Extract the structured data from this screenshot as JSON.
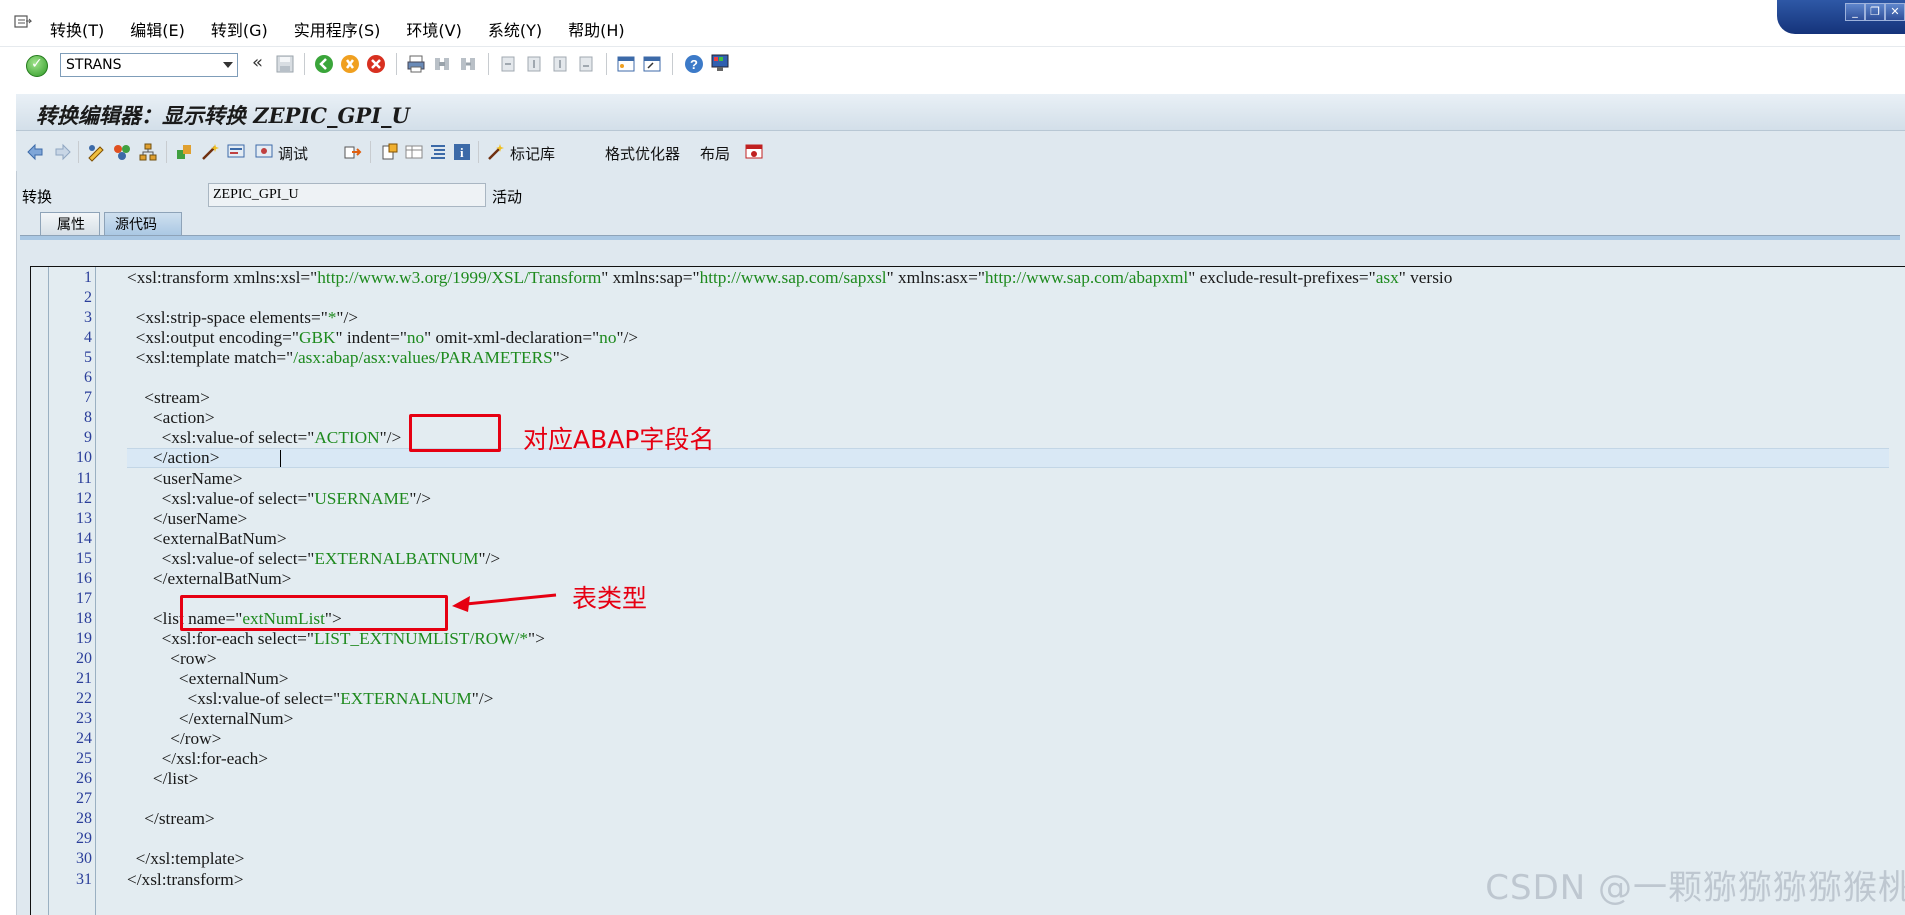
{
  "menu": {
    "items": [
      "转换(T)",
      "编辑(E)",
      "转到(G)",
      "实用程序(S)",
      "环境(V)",
      "系统(Y)",
      "帮助(H)"
    ]
  },
  "command_field": {
    "value": "STRANS"
  },
  "window_title": "转换编辑器：显示转换 ZEPIC_GPI_U",
  "app_toolbar": {
    "debug_label": "调试",
    "tag_library_label": "标记库",
    "pretty_printer_label": "格式优化器",
    "layout_label": "布局"
  },
  "field": {
    "label": "转换",
    "value": "ZEPIC_GPI_U",
    "status": "活动"
  },
  "tabs": [
    "属性",
    "源代码"
  ],
  "editor": {
    "current_line": 10,
    "lines": [
      "<xsl:transform xmlns:xsl=\"http://www.w3.org/1999/XSL/Transform\" xmlns:sap=\"http://www.sap.com/sapxsl\" xmlns:asx=\"http://www.sap.com/abapxml\" exclude-result-prefixes=\"asx\" versio",
      "",
      "  <xsl:strip-space elements=\"*\"/>",
      "  <xsl:output encoding=\"GBK\" indent=\"no\" omit-xml-declaration=\"no\"/>",
      "  <xsl:template match=\"/asx:abap/asx:values/PARAMETERS\">",
      "",
      "    <stream>",
      "      <action>",
      "        <xsl:value-of select=\"ACTION\"/>",
      "      </action>",
      "      <userName>",
      "        <xsl:value-of select=\"USERNAME\"/>",
      "      </userName>",
      "      <externalBatNum>",
      "        <xsl:value-of select=\"EXTERNALBATNUM\"/>",
      "      </externalBatNum>",
      "",
      "      <list name=\"extNumList\">",
      "        <xsl:for-each select=\"LIST_EXTNUMLIST/ROW/*\">",
      "          <row>",
      "            <externalNum>",
      "              <xsl:value-of select=\"EXTERNALNUM\"/>",
      "            </externalNum>",
      "          </row>",
      "        </xsl:for-each>",
      "      </list>",
      "",
      "    </stream>",
      "",
      "  </xsl:template>",
      "</xsl:transform>"
    ]
  },
  "annotations": {
    "field_name_note": "对应ABAP字段名",
    "table_type_note": "表类型",
    "accent_color": "#e60012"
  },
  "watermark": "CSDN @一颗猕猕猕猕猴桃"
}
